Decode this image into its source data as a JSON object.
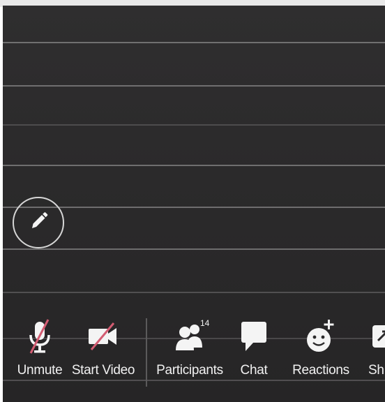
{
  "toolbar": {
    "unmute_label": "Unmute",
    "start_video_label": "Start Video",
    "participants_label": "Participants",
    "participants_count": "14",
    "chat_label": "Chat",
    "reactions_label": "Reactions",
    "share_label": "Sh"
  },
  "icons": {
    "annotate": "pencil-icon",
    "unmute": "microphone-muted-icon",
    "start_video": "video-camera-off-icon",
    "participants": "people-icon",
    "chat": "speech-bubble-icon",
    "reactions": "smiley-plus-icon",
    "share": "share-screen-icon"
  },
  "colors": {
    "background": "#2b2a2b",
    "toolbar_text": "#f1f1f1",
    "muted_slash": "#d35c72",
    "icon": "#f4f4f4"
  }
}
